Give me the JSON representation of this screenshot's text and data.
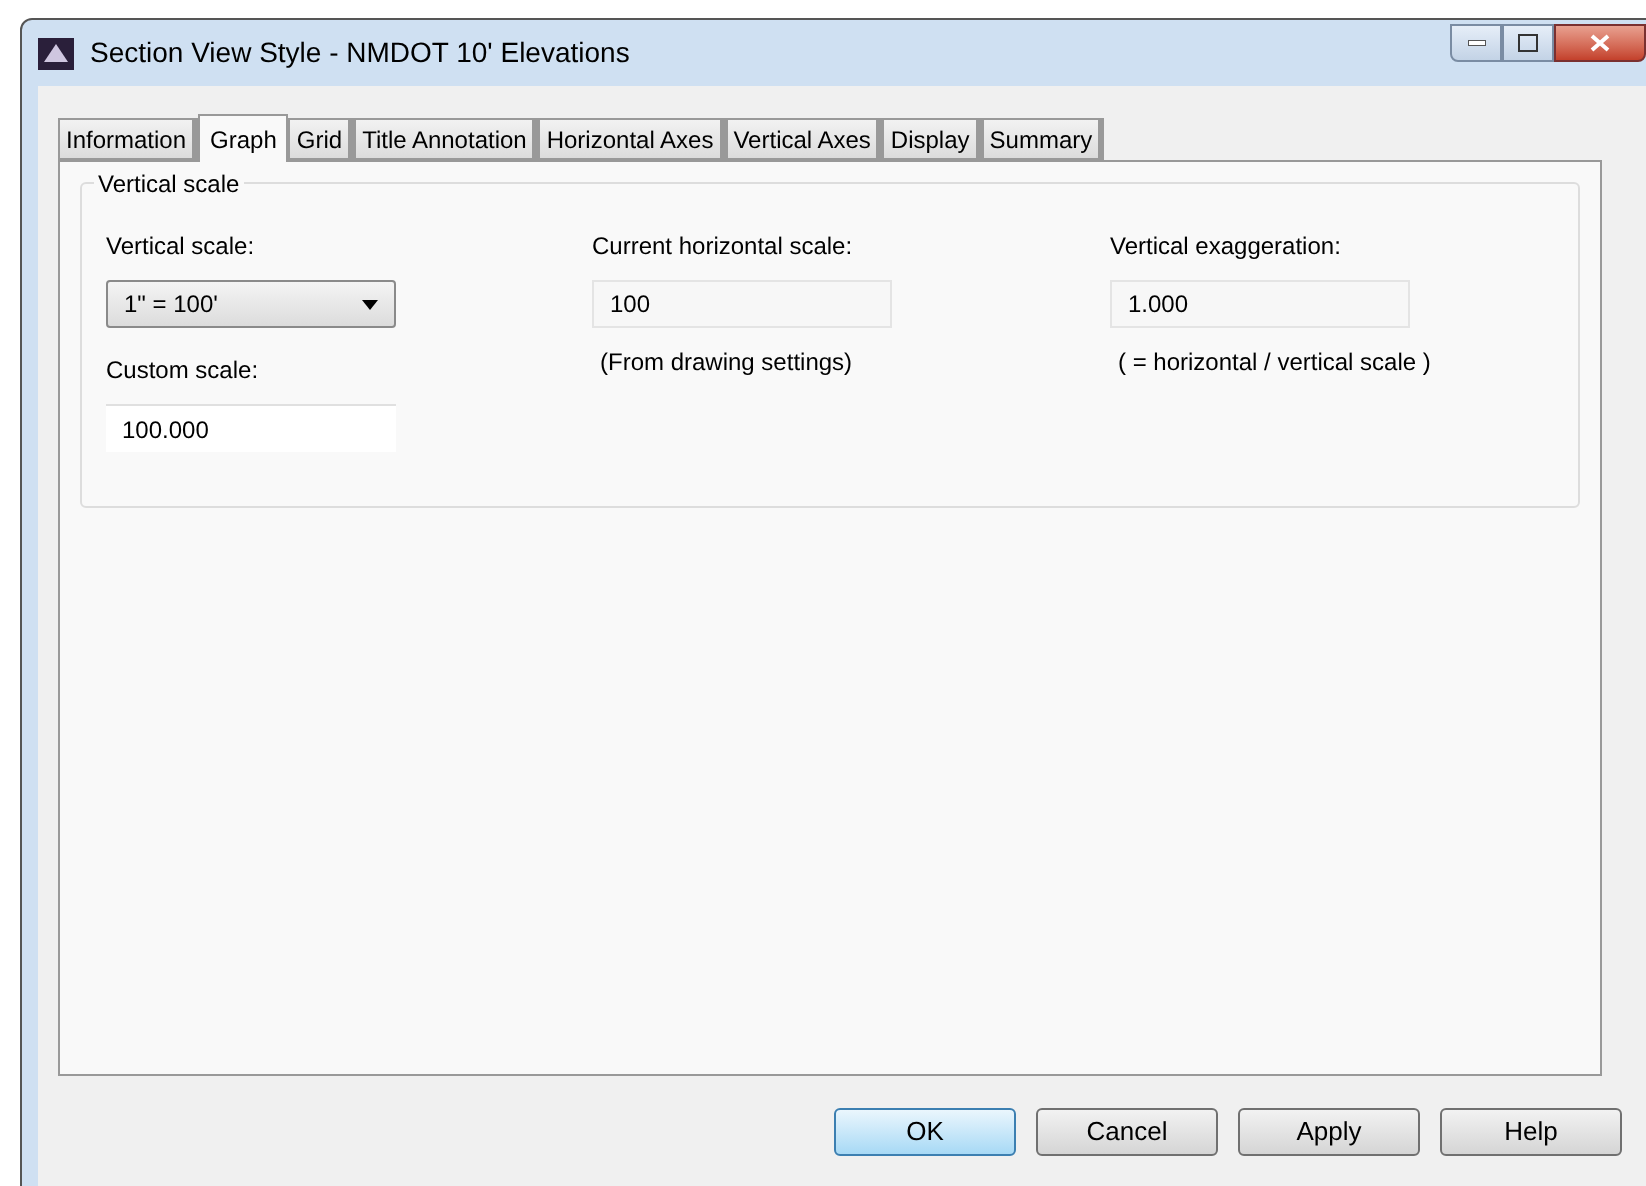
{
  "window": {
    "title": "Section View Style - NMDOT 10' Elevations"
  },
  "tabs": [
    {
      "label": "Information",
      "selected": false
    },
    {
      "label": "Graph",
      "selected": true
    },
    {
      "label": "Grid",
      "selected": false
    },
    {
      "label": "Title Annotation",
      "selected": false
    },
    {
      "label": "Horizontal Axes",
      "selected": false
    },
    {
      "label": "Vertical Axes",
      "selected": false
    },
    {
      "label": "Display",
      "selected": false
    },
    {
      "label": "Summary",
      "selected": false
    }
  ],
  "group": {
    "title": "Vertical scale",
    "columns": [
      [
        {
          "kind": "dropdown",
          "label": "Vertical scale:",
          "value": "1\" = 100'"
        },
        {
          "kind": "input",
          "label": "Custom scale:",
          "value": "100.000"
        }
      ],
      [
        {
          "kind": "readonly",
          "label": "Current horizontal scale:",
          "value": "100"
        },
        {
          "kind": "note",
          "text": "(From drawing settings)"
        }
      ],
      [
        {
          "kind": "readonly",
          "label": "Vertical exaggeration:",
          "value": "1.000"
        },
        {
          "kind": "note",
          "text": "( = horizontal / vertical scale )"
        }
      ]
    ]
  },
  "buttons": [
    {
      "label": "OK",
      "default": true
    },
    {
      "label": "Cancel",
      "default": false
    },
    {
      "label": "Apply",
      "default": false
    },
    {
      "label": "Help",
      "default": false
    }
  ]
}
